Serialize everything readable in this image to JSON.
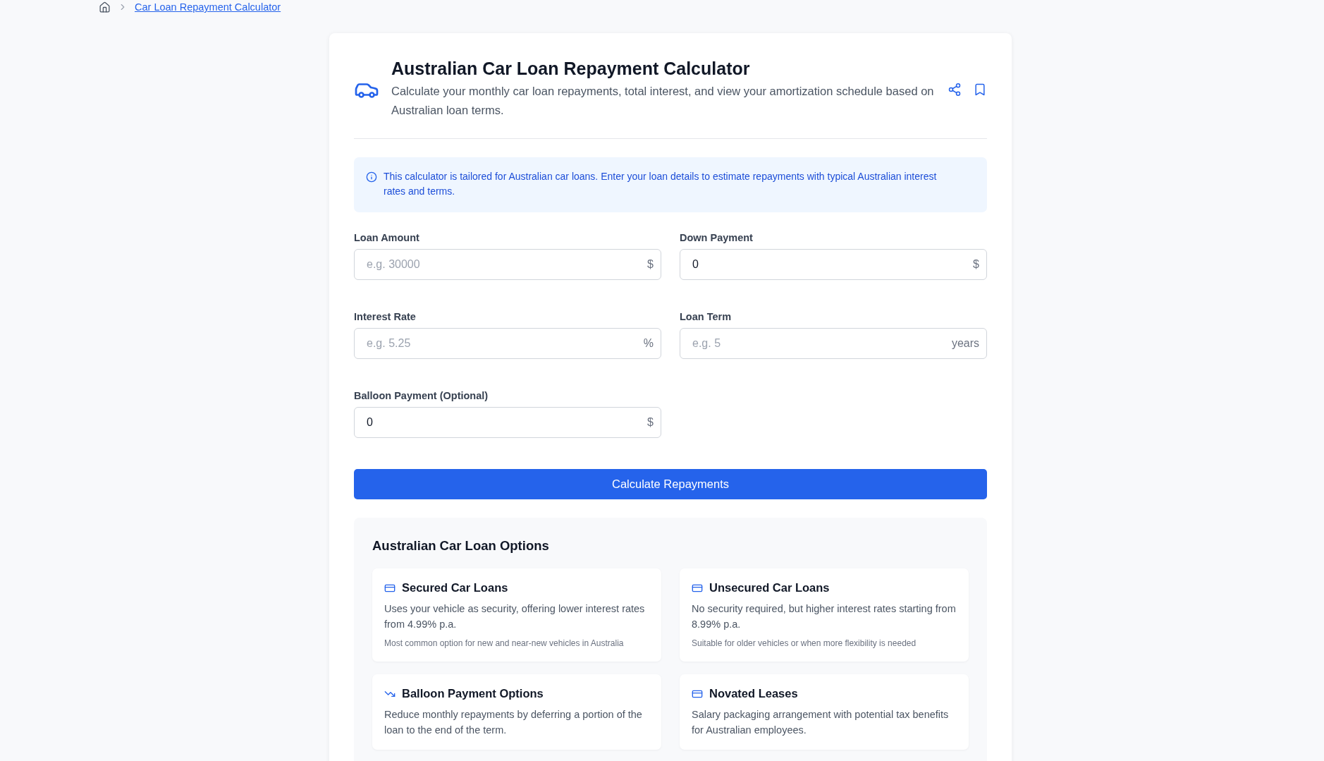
{
  "breadcrumb": {
    "current": "Car Loan Repayment Calculator"
  },
  "calculator": {
    "title": "Australian Car Loan Repayment Calculator",
    "description": "Calculate your monthly car loan repayments, total interest, and view your amortization schedule based on Australian loan terms.",
    "notice": "This calculator is tailored for Australian car loans. Enter your loan details to estimate repayments with typical Australian interest rates and terms."
  },
  "fields": [
    {
      "label": "Loan Amount",
      "placeholder": "e.g. 30000",
      "unit": "$"
    },
    {
      "label": "Down Payment",
      "value": "0",
      "unit": "$"
    },
    {
      "label": "Interest Rate",
      "placeholder": "e.g. 5.25",
      "unit": "%"
    },
    {
      "label": "Loan Term",
      "placeholder": "e.g. 5",
      "unit": "years"
    },
    {
      "label": "Balloon Payment (Optional)",
      "value": "0",
      "unit": "$"
    }
  ],
  "calculate_button": "Calculate Repayments",
  "loan_options": {
    "title": "Australian Car Loan Options",
    "cards": [
      {
        "kind": "card",
        "title": "Secured Car Loans",
        "description": "Uses your vehicle as security, offering lower interest rates from 4.99% p.a.",
        "note": "Most common option for new and near-new vehicles in Australia"
      },
      {
        "kind": "card",
        "title": "Unsecured Car Loans",
        "description": "No security required, but higher interest rates starting from 8.99% p.a.",
        "note": "Suitable for older vehicles or when more flexibility is needed"
      },
      {
        "kind": "trend",
        "title": "Balloon Payment Options",
        "description": "Reduce monthly repayments by deferring a portion of the loan to the end of the term."
      },
      {
        "kind": "card",
        "title": "Novated Leases",
        "description": "Salary packaging arrangement with potential tax benefits for Australian employees."
      }
    ]
  }
}
